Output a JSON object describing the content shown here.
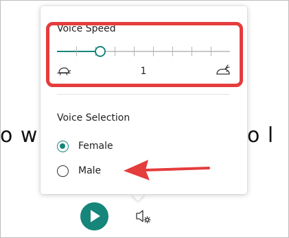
{
  "background_text": {
    "left": "o w",
    "right": "o l"
  },
  "voice_speed": {
    "title": "Voice Speed",
    "value": "1",
    "slider_level": 0.25,
    "tick_count": 8
  },
  "voice_selection": {
    "title": "Voice Selection",
    "options": [
      {
        "label": "Female",
        "checked": true
      },
      {
        "label": "Male",
        "checked": false
      }
    ]
  },
  "icons": {
    "slow": "turtle-icon",
    "fast": "rabbit-icon",
    "play": "play-icon",
    "settings": "speaker-gear-icon"
  },
  "colors": {
    "accent": "#16857a",
    "annotation": "#e53c3c"
  }
}
